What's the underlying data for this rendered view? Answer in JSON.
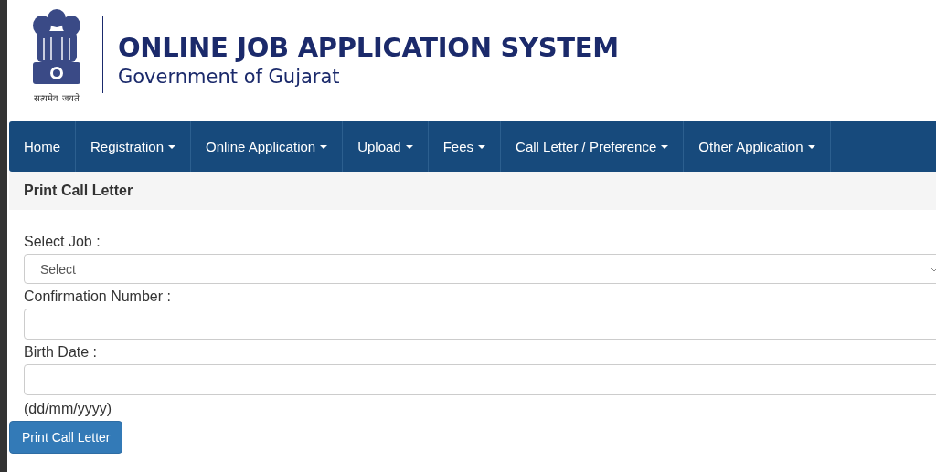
{
  "header": {
    "emblem_motto": "सत्यमेव जयते",
    "title": "ONLINE JOB APPLICATION SYSTEM",
    "subtitle": "Government of Gujarat"
  },
  "nav": [
    {
      "label": "Home",
      "dropdown": false
    },
    {
      "label": "Registration",
      "dropdown": true
    },
    {
      "label": "Online Application",
      "dropdown": true
    },
    {
      "label": "Upload",
      "dropdown": true
    },
    {
      "label": "Fees",
      "dropdown": true
    },
    {
      "label": "Call Letter / Preference",
      "dropdown": true
    },
    {
      "label": "Other Application",
      "dropdown": true
    }
  ],
  "panel": {
    "title": "Print Call Letter"
  },
  "form": [
    {
      "kind": "select",
      "label": "Select Job :",
      "value": "Select"
    },
    {
      "kind": "text",
      "label": "Confirmation Number :"
    },
    {
      "kind": "text",
      "label": "Birth Date :",
      "hint": "(dd/mm/yyyy)"
    }
  ],
  "submit": "Print Call Letter"
}
